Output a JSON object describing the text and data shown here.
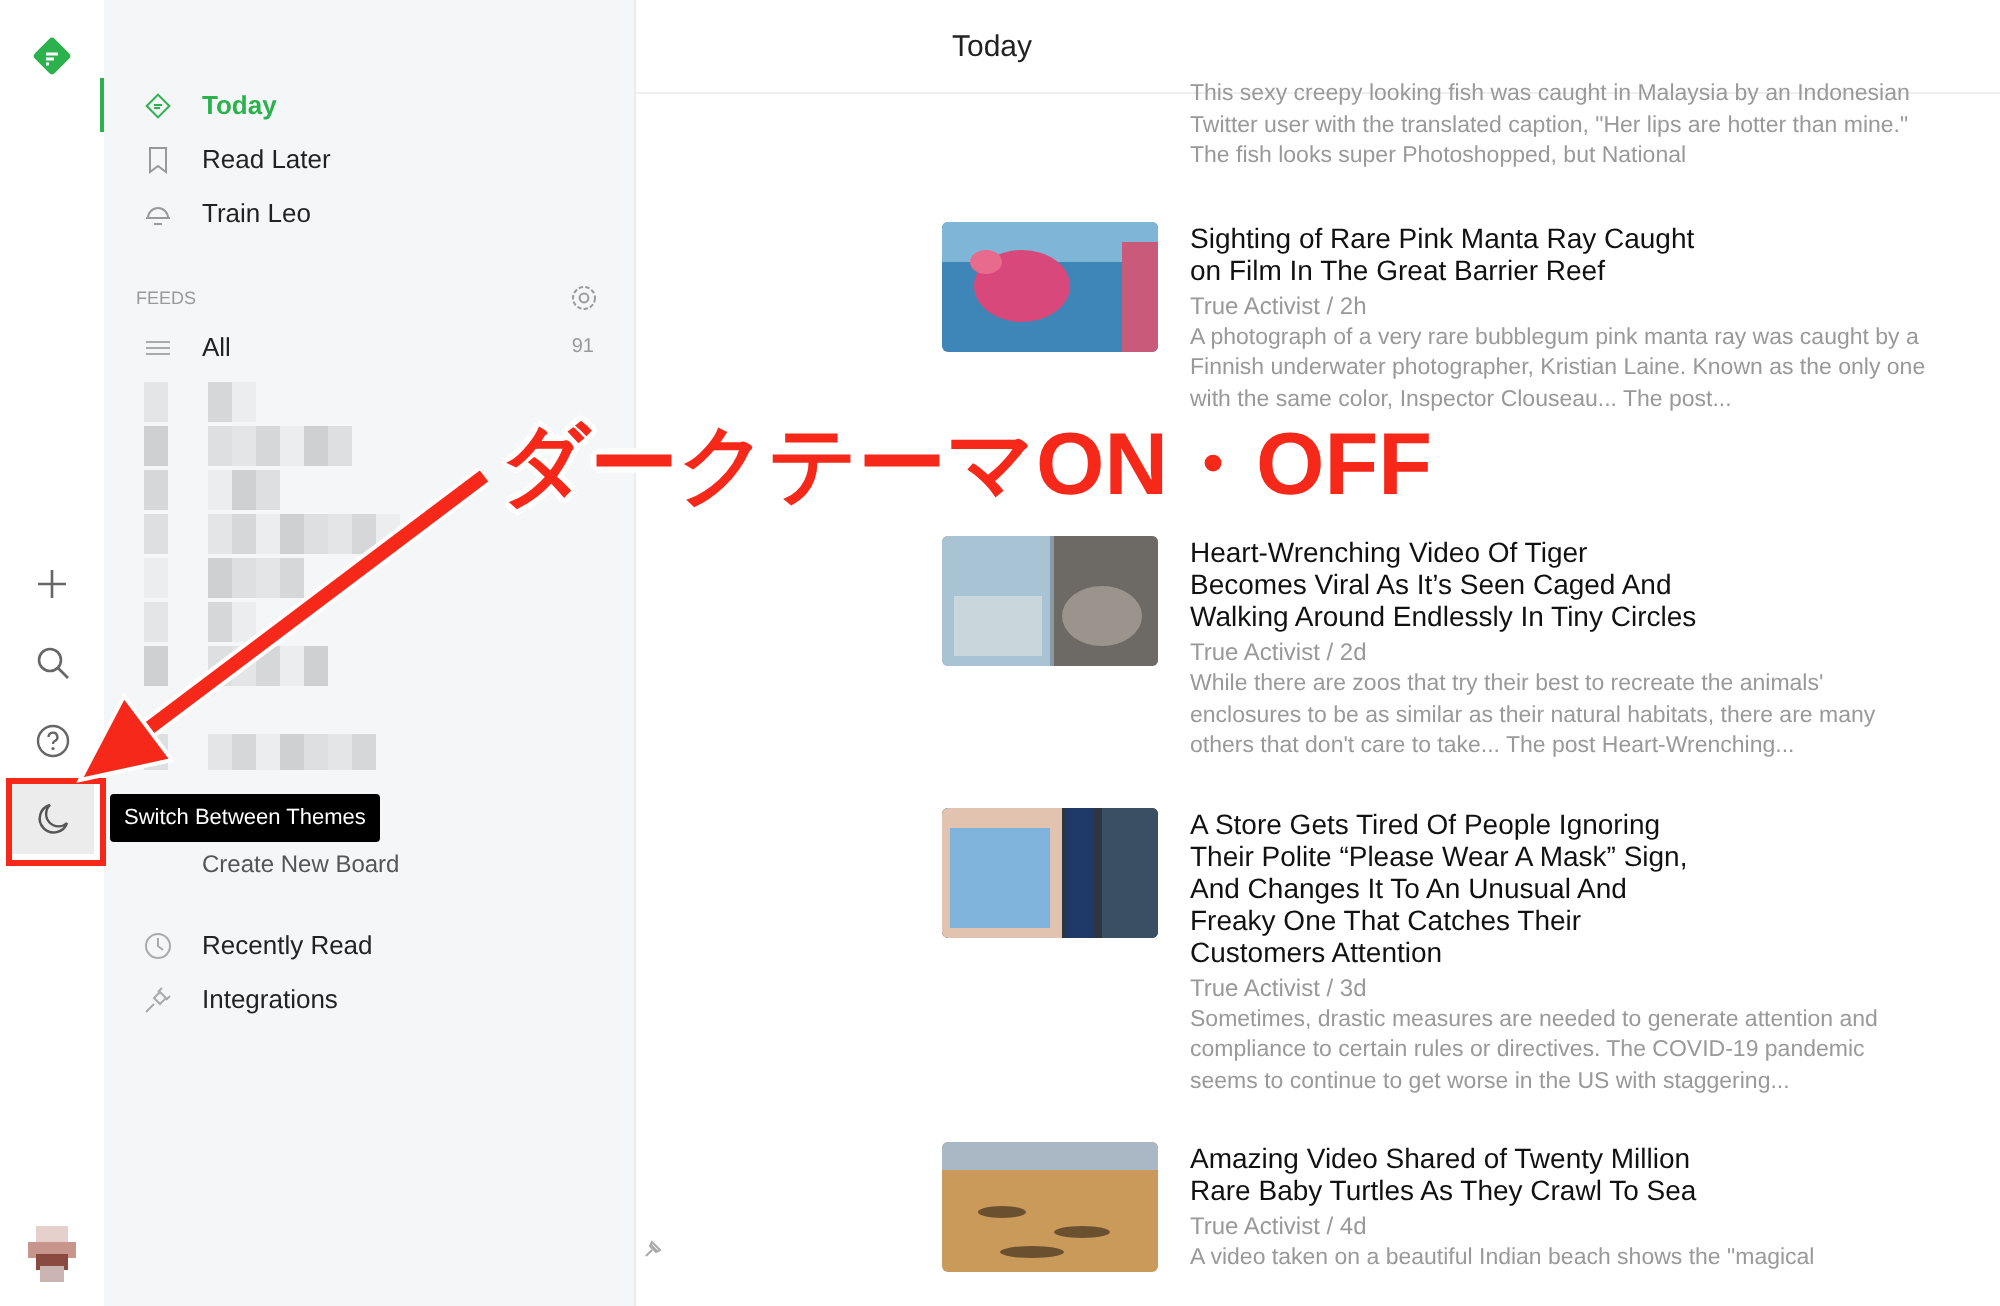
{
  "rail": {
    "buttons": [
      {
        "kind": "add",
        "selected": false
      },
      {
        "kind": "search",
        "selected": false
      },
      {
        "kind": "help",
        "selected": false
      },
      {
        "kind": "theme",
        "selected": true
      }
    ]
  },
  "sidebar": {
    "nav": [
      {
        "label": "Today",
        "kind": "today",
        "selected": true
      },
      {
        "label": "Read Later",
        "kind": "bookmark",
        "selected": false
      },
      {
        "label": "Train Leo",
        "kind": "leo",
        "selected": false
      }
    ],
    "feeds_heading": "FEEDS",
    "feeds": [
      {
        "label": "All",
        "count": "91"
      }
    ],
    "board_link": "Create New Board",
    "bottom_nav": [
      {
        "label": "Recently Read",
        "kind": "clock"
      },
      {
        "label": "Integrations",
        "kind": "plug"
      }
    ]
  },
  "tooltip": {
    "text": "Switch Between Themes"
  },
  "main": {
    "title": "Today",
    "articles": [
      {
        "description": "This sexy creepy looking fish was caught in Malaysia by an Indonesian Twitter user with the translated caption, \"Her lips are hotter than mine.\" The fish looks super Photoshopped, but National"
      },
      {
        "title": "Sighting of Rare Pink Manta Ray Caught on Film In The Great Barrier Reef",
        "source": "True Activist / 2h",
        "description": "A photograph of a very rare bubblegum pink manta ray was caught by a Finnish underwater photographer, Kristian Laine. Known as the only one with the same color, Inspector Clouseau... The post..."
      },
      {
        "title": "Heart-Wrenching Video Of Tiger Becomes Viral As It’s Seen Caged And Walking Around Endlessly In Tiny Circles",
        "source": "True Activist / 2d",
        "description": "While there are zoos that try their best to recreate the animals' enclosures to be as similar as their natural habitats, there are many others that don't care to take... The post Heart-Wrenching..."
      },
      {
        "title": "A Store Gets Tired Of People Ignoring Their Polite “Please Wear A Mask” Sign, And Changes It To An Unusual And Freaky One That Catches Their Customers Attention",
        "source": "True Activist / 3d",
        "description": "Sometimes, drastic measures are needed to generate attention and compliance to certain rules or directives. The COVID-19 pandemic seems to continue to get worse in the US with staggering..."
      },
      {
        "title": "Amazing Video Shared of Twenty Million Rare Baby Turtles As They Crawl To Sea",
        "source": "True Activist / 4d",
        "description": "A video taken on a beautiful Indian beach shows the \"magical"
      }
    ]
  },
  "annotation": {
    "text": "ダークテーマON・OFF"
  }
}
